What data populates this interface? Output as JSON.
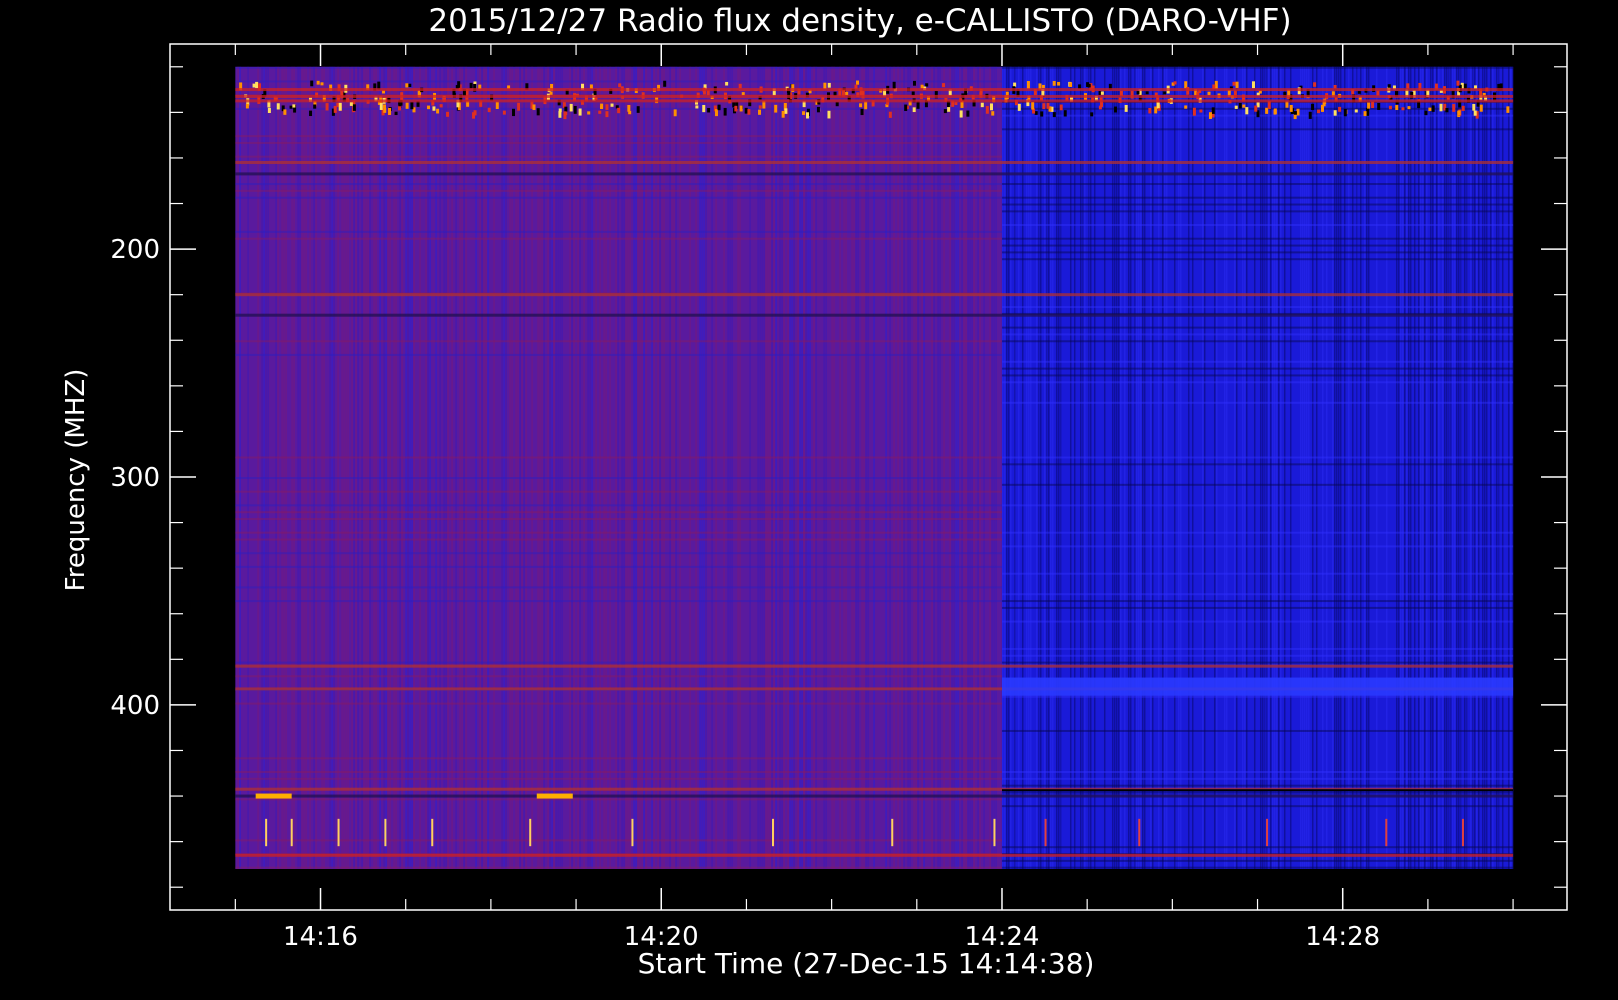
{
  "chart_data": {
    "type": "heatmap",
    "title": "2015/12/27  Radio flux density, e-CALLISTO (DARO-VHF)",
    "xlabel": "Start Time (27-Dec-15 14:14:38)",
    "ylabel": "Frequency (MHZ)",
    "x_ticks": [
      "14:16",
      "14:20",
      "14:24",
      "14:28"
    ],
    "x_tick_minutes": [
      16,
      20,
      24,
      28
    ],
    "xlim_minutes": [
      14.233,
      30.633
    ],
    "data_minutes": [
      15.0,
      30.0
    ],
    "y_ticks": [
      200,
      300,
      400
    ],
    "ylim": [
      110,
      490
    ],
    "data_ylim": [
      120,
      472
    ],
    "minor_tick_step_minutes": 1,
    "minor_tick_step_mhz": 20,
    "segments": [
      {
        "name": "",
        "start_minute": 15.0,
        "end_minute": 24.0,
        "base_color": "#5a1a9e"
      },
      {
        "name": "",
        "start_minute": 24.0,
        "end_minute": 30.0,
        "base_color": "#1a1ad8"
      }
    ],
    "bands_mhz": [
      {
        "mhz": 130,
        "intensity": "high"
      },
      {
        "mhz": 133,
        "intensity": "high"
      },
      {
        "mhz": 135,
        "intensity": "high"
      },
      {
        "mhz": 162,
        "intensity": "medium"
      },
      {
        "mhz": 167,
        "intensity": "low"
      },
      {
        "mhz": 220,
        "intensity": "medium"
      },
      {
        "mhz": 229,
        "intensity": "low"
      },
      {
        "mhz": 383,
        "intensity": "medium"
      },
      {
        "mhz": 393,
        "intensity": "medium"
      },
      {
        "mhz": 437,
        "intensity": "medium"
      },
      {
        "mhz": 440,
        "intensity": "low"
      },
      {
        "mhz": 466,
        "intensity": "high"
      }
    ],
    "bursts": [
      {
        "minute": 15.45,
        "mhz": 440,
        "color": "#ffb000"
      },
      {
        "minute": 18.75,
        "mhz": 440,
        "color": "#ffb000"
      },
      {
        "minute": 15.35,
        "mhz": 455,
        "color": "#ffd060"
      },
      {
        "minute": 15.65,
        "mhz": 455,
        "color": "#ffd060"
      },
      {
        "minute": 16.2,
        "mhz": 455,
        "color": "#ffd060"
      },
      {
        "minute": 16.75,
        "mhz": 455,
        "color": "#ffd060"
      },
      {
        "minute": 17.3,
        "mhz": 455,
        "color": "#ffd060"
      },
      {
        "minute": 18.45,
        "mhz": 455,
        "color": "#ffd060"
      },
      {
        "minute": 19.65,
        "mhz": 455,
        "color": "#ffd060"
      },
      {
        "minute": 21.3,
        "mhz": 455,
        "color": "#ffd060"
      },
      {
        "minute": 22.7,
        "mhz": 455,
        "color": "#ffd060"
      },
      {
        "minute": 23.9,
        "mhz": 455,
        "color": "#ffd060"
      },
      {
        "minute": 24.5,
        "mhz": 455,
        "color": "#e04040"
      },
      {
        "minute": 25.6,
        "mhz": 455,
        "color": "#e04040"
      },
      {
        "minute": 27.1,
        "mhz": 455,
        "color": "#e04040"
      },
      {
        "minute": 28.5,
        "mhz": 455,
        "color": "#e04040"
      },
      {
        "minute": 29.4,
        "mhz": 455,
        "color": "#e04040"
      }
    ],
    "grid": false,
    "colormap": "dark blue-violet-red-yellow"
  }
}
